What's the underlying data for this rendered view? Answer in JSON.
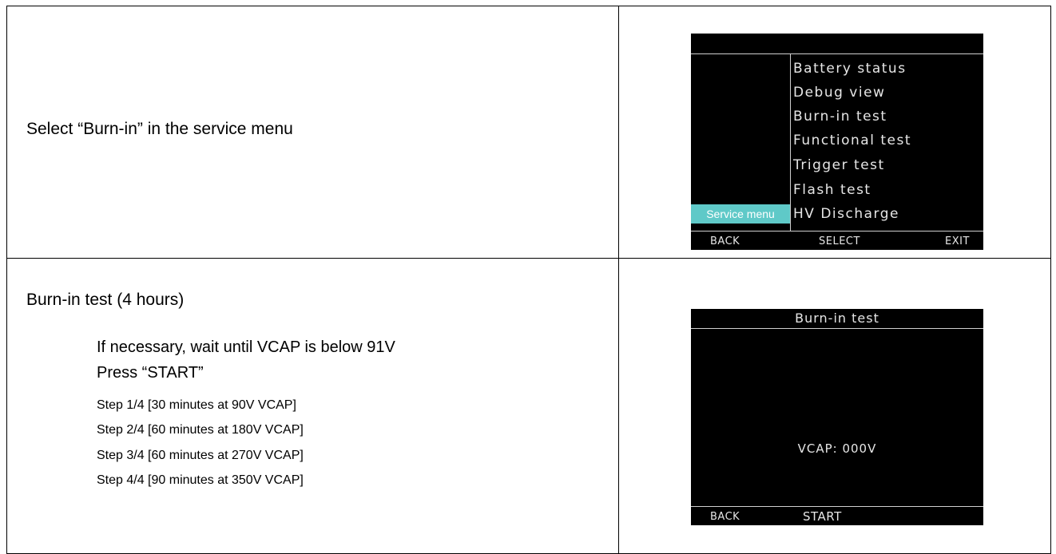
{
  "rows": [
    {
      "instruction": "Select “Burn-in” in the service menu"
    },
    {
      "instruction": "Burn-in test (4 hours)",
      "wait_line": "If necessary, wait until VCAP is below 91V",
      "press_line": "Press “START”",
      "steps": [
        "Step 1/4 [30 minutes at 90V VCAP]",
        "Step 2/4 [60 minutes at 180V VCAP]",
        "Step 3/4 [60 minutes at 270V VCAP]",
        "Step 4/4 [90 minutes at 350V VCAP]"
      ]
    }
  ],
  "service_screen": {
    "menu_label": "Service menu",
    "items": [
      "Battery status",
      "Debug view",
      "Burn-in test",
      "Functional test",
      "Trigger test",
      "Flash test",
      "HV Discharge"
    ],
    "softkeys": {
      "left": "BACK",
      "center": "SELECT",
      "right": "EXIT"
    }
  },
  "burnin_screen": {
    "title": "Burn-in test",
    "vcap": "VCAP: 000V",
    "softkeys": {
      "left": "BACK",
      "center": "START"
    }
  },
  "colors": {
    "screen_bg": "#000000",
    "screen_text": "#e6e6e6",
    "highlight": "#5fc9c8"
  }
}
